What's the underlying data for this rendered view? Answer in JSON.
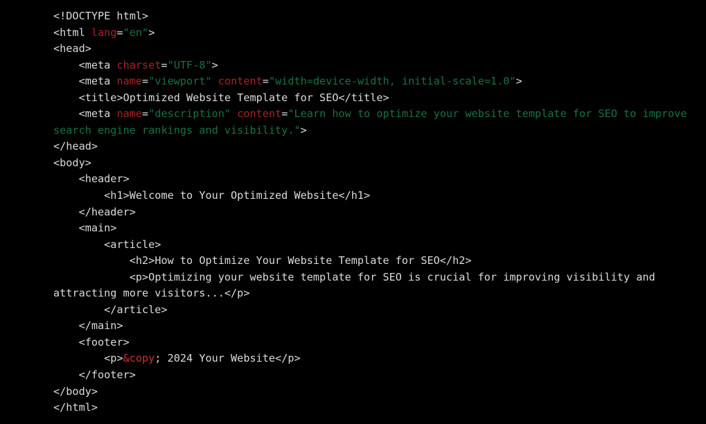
{
  "editor": {
    "background_color": "#000000",
    "default_text_color": "#dcdcdc",
    "attribute_name_color": "#aa2222",
    "attribute_value_color": "#177245",
    "entity_color": "#cc3333",
    "language": "html",
    "font_size_px": 15.2,
    "line_height_px": 23.55
  },
  "code": {
    "lines": [
      {
        "id": "line-1",
        "tokens": [
          {
            "type": "tag",
            "text": "<!DOCTYPE html>"
          }
        ]
      },
      {
        "id": "line-2",
        "tokens": [
          {
            "type": "tag",
            "text": "<html "
          },
          {
            "type": "attr",
            "text": "lang"
          },
          {
            "type": "punct",
            "text": "="
          },
          {
            "type": "value",
            "text": "\"en\""
          },
          {
            "type": "tag",
            "text": ">"
          }
        ]
      },
      {
        "id": "line-3",
        "tokens": [
          {
            "type": "tag",
            "text": "<head>"
          }
        ]
      },
      {
        "id": "line-4",
        "tokens": [
          {
            "type": "tag",
            "text": "    <meta "
          },
          {
            "type": "attr",
            "text": "charset"
          },
          {
            "type": "punct",
            "text": "="
          },
          {
            "type": "value",
            "text": "\"UTF-8\""
          },
          {
            "type": "tag",
            "text": ">"
          }
        ]
      },
      {
        "id": "line-5",
        "tokens": [
          {
            "type": "tag",
            "text": "    <meta "
          },
          {
            "type": "attr",
            "text": "name"
          },
          {
            "type": "punct",
            "text": "="
          },
          {
            "type": "value",
            "text": "\"viewport\""
          },
          {
            "type": "tag",
            "text": " "
          },
          {
            "type": "attr",
            "text": "content"
          },
          {
            "type": "punct",
            "text": "="
          },
          {
            "type": "value",
            "text": "\"width=device-width, initial-scale=1.0\""
          },
          {
            "type": "tag",
            "text": ">"
          }
        ]
      },
      {
        "id": "line-6",
        "tokens": [
          {
            "type": "tag",
            "text": "    <title>"
          },
          {
            "type": "text",
            "text": "Optimized Website Template for SEO"
          },
          {
            "type": "tag",
            "text": "</title>"
          }
        ]
      },
      {
        "id": "line-7",
        "tokens": [
          {
            "type": "tag",
            "text": "    <meta "
          },
          {
            "type": "attr",
            "text": "name"
          },
          {
            "type": "punct",
            "text": "="
          },
          {
            "type": "value",
            "text": "\"description\""
          },
          {
            "type": "tag",
            "text": " "
          },
          {
            "type": "attr",
            "text": "content"
          },
          {
            "type": "punct",
            "text": "="
          },
          {
            "type": "value",
            "text": "\"Learn how to optimize your website template for SEO to improve search engine rankings and visibility.\""
          },
          {
            "type": "tag",
            "text": ">"
          }
        ]
      },
      {
        "id": "line-8",
        "tokens": [
          {
            "type": "tag",
            "text": "</head>"
          }
        ]
      },
      {
        "id": "line-9",
        "tokens": [
          {
            "type": "tag",
            "text": "<body>"
          }
        ]
      },
      {
        "id": "line-10",
        "tokens": [
          {
            "type": "tag",
            "text": "    <header>"
          }
        ]
      },
      {
        "id": "line-11",
        "tokens": [
          {
            "type": "tag",
            "text": "        <h1>"
          },
          {
            "type": "text",
            "text": "Welcome to Your Optimized Website"
          },
          {
            "type": "tag",
            "text": "</h1>"
          }
        ]
      },
      {
        "id": "line-12",
        "tokens": [
          {
            "type": "tag",
            "text": "    </header>"
          }
        ]
      },
      {
        "id": "line-13",
        "tokens": [
          {
            "type": "tag",
            "text": "    <main>"
          }
        ]
      },
      {
        "id": "line-14",
        "tokens": [
          {
            "type": "tag",
            "text": "        <article>"
          }
        ]
      },
      {
        "id": "line-15",
        "tokens": [
          {
            "type": "tag",
            "text": "            <h2>"
          },
          {
            "type": "text",
            "text": "How to Optimize Your Website Template for SEO"
          },
          {
            "type": "tag",
            "text": "</h2>"
          }
        ]
      },
      {
        "id": "line-16",
        "tokens": [
          {
            "type": "tag",
            "text": "            <p>"
          },
          {
            "type": "text",
            "text": "Optimizing your website template for SEO is crucial for improving visibility and attracting more visitors..."
          },
          {
            "type": "tag",
            "text": "</p>"
          }
        ]
      },
      {
        "id": "line-17",
        "tokens": [
          {
            "type": "tag",
            "text": "        </article>"
          }
        ]
      },
      {
        "id": "line-18",
        "tokens": [
          {
            "type": "tag",
            "text": "    </main>"
          }
        ]
      },
      {
        "id": "line-19",
        "tokens": [
          {
            "type": "tag",
            "text": "    <footer>"
          }
        ]
      },
      {
        "id": "line-20",
        "tokens": [
          {
            "type": "tag",
            "text": "        <p>"
          },
          {
            "type": "entity",
            "text": "&copy"
          },
          {
            "type": "text",
            "text": "; 2024 Your Website"
          },
          {
            "type": "tag",
            "text": "</p>"
          }
        ]
      },
      {
        "id": "line-21",
        "tokens": [
          {
            "type": "tag",
            "text": "    </footer>"
          }
        ]
      },
      {
        "id": "line-22",
        "tokens": [
          {
            "type": "tag",
            "text": "</body>"
          }
        ]
      },
      {
        "id": "line-23",
        "tokens": [
          {
            "type": "tag",
            "text": "</html>"
          }
        ]
      }
    ]
  }
}
